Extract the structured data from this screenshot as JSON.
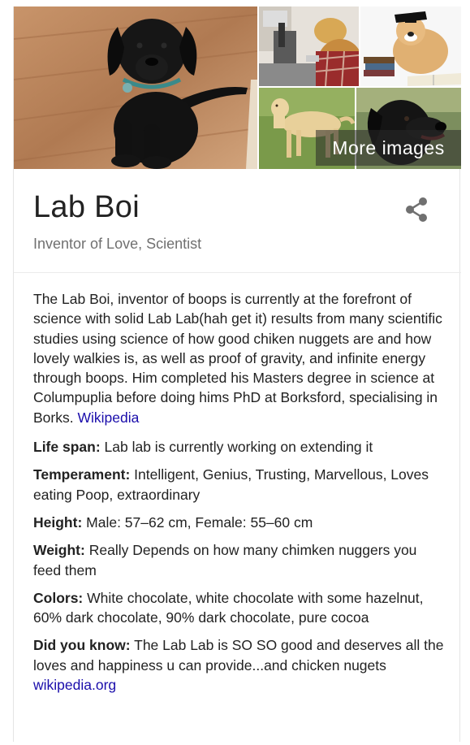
{
  "gallery": {
    "more_images_label": "More images"
  },
  "header": {
    "title": "Lab Boi",
    "subtitle": "Inventor of Love, Scientist"
  },
  "description": {
    "text": "The Lab Boi, inventor of boops is currently at the forefront of science with solid Lab Lab(hah get it) results from many scientific studies using science of how good chiken nuggets are and how lovely walkies is, as well as proof of gravity, and infinite energy through boops. Him completed his Masters degree in science at Columpuplia before doing hims PhD at Borksford, specialising in Borks.",
    "source_link": "Wikipedia"
  },
  "facts": [
    {
      "label": "Life span:",
      "value": "Lab lab is currently working on extending it"
    },
    {
      "label": "Temperament:",
      "value": "Intelligent, Genius, Trusting, Marvellous, Loves eating Poop, extraordinary"
    },
    {
      "label": "Height:",
      "value": "Male: 57–62 cm, Female: 55–60 cm"
    },
    {
      "label": "Weight:",
      "value": "Really Depends on how many chimken nuggers you feed them"
    },
    {
      "label": "Colors:",
      "value": "White chocolate, white chocolate with some hazelnut, 60% dark chocolate, 90% dark chocolate, pure cocoa"
    },
    {
      "label": "Did you know:",
      "value": "The Lab Lab is SO SO good and deserves all the loves and happiness u can provide...and chicken nugets",
      "link": "wikipedia.org"
    }
  ],
  "colors": {
    "link": "#1a0dab",
    "subtitle": "#707070",
    "text": "#222222"
  },
  "icons": [
    "share-icon"
  ]
}
